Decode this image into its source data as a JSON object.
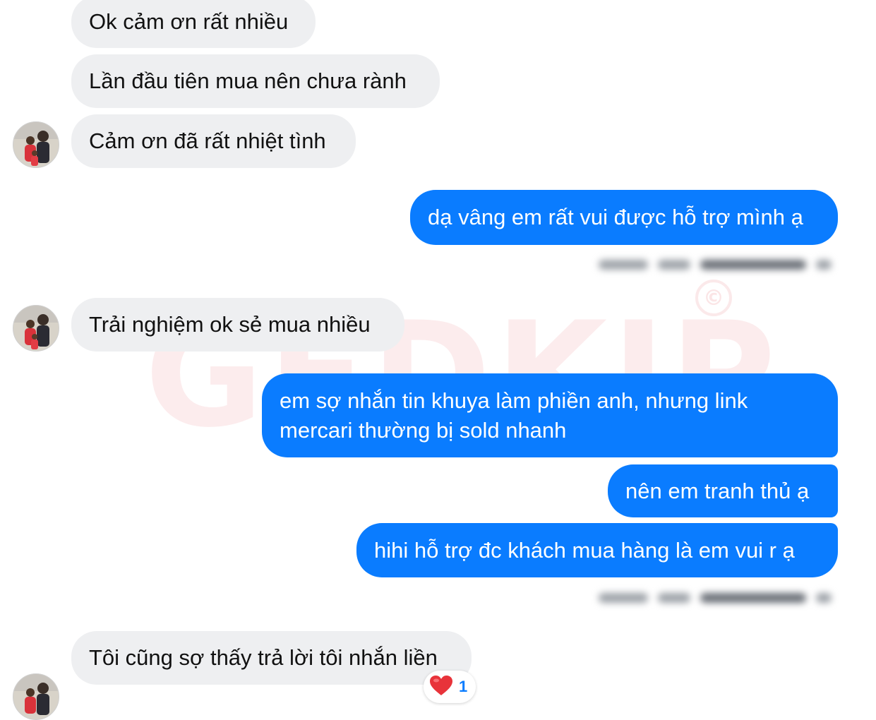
{
  "watermark": {
    "text": "GEDKIP",
    "symbol": "©"
  },
  "messages": {
    "m1": "Ok cảm ơn rất nhiều",
    "m2": "Lần đầu tiên mua nên chưa rành",
    "m3": "Cảm ơn đã rất nhiệt tình",
    "m4": "dạ vâng em rất vui được hỗ trợ mình ạ",
    "m5": "Trải nghiệm ok sẻ mua nhiều",
    "m6": "em sợ nhắn tin khuya làm phiền anh, nhưng link mercari thường bị sold nhanh",
    "m7": "nên em tranh thủ ạ",
    "m8": "hihi hỗ trợ đc khách mua hàng là em vui r ạ",
    "m9": "Tôi cũng sợ thấy trả lời tôi nhắn liền"
  },
  "reaction": {
    "icon": "heart-icon",
    "count": "1"
  },
  "colors": {
    "outgoing": "#0a7cff",
    "incoming": "#eeeff1",
    "reaction": "#e8333a"
  }
}
